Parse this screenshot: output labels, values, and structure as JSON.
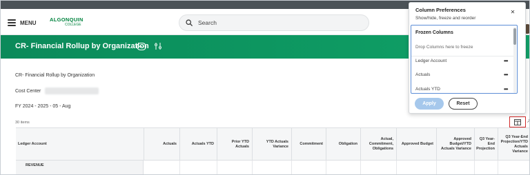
{
  "header": {
    "menu_label": "MENU",
    "logo_line1": "ALGONQUIN",
    "logo_line2": "COLLEGE",
    "search_placeholder": "Search"
  },
  "report": {
    "title": "CR- Financial Rollup by Organization",
    "name_line": "CR- Financial Rollup by Organization",
    "cost_center_label": "Cost Center",
    "period_line": "FY 2024 - 2025 - 05 - Aug",
    "items_count": "30 items"
  },
  "table": {
    "columns": [
      "Ledger Account",
      "Actuals",
      "Actuals YTD",
      "Prior YTD Actuals",
      "YTD Actuals Variance",
      "Commitment",
      "Obligation",
      "Actual, Commitment, Obligations",
      "Approved Budget",
      "Approved Budget/YTD Actuals Variance",
      "Q3 Year-End Projection",
      "Q3 Year-End Projection/YTD Actuals Variance"
    ],
    "rows": [
      {
        "ledger_account": "REVENUE"
      }
    ]
  },
  "column_preferences": {
    "title": "Column Preferences",
    "subtitle": "Show/hide, freeze and reorder",
    "frozen_header": "Frozen Columns",
    "drop_hint": "Drop Columns here to freeze",
    "columns": [
      "Ledger Account",
      "Actuals",
      "Actuals YTD"
    ],
    "apply_label": "Apply",
    "reset_label": "Reset"
  },
  "colors": {
    "brand_green": "#0e9b63",
    "apply_blue": "#a6c8ec",
    "focus_blue": "#5b8dd6",
    "highlight_red": "#d12a2a"
  }
}
